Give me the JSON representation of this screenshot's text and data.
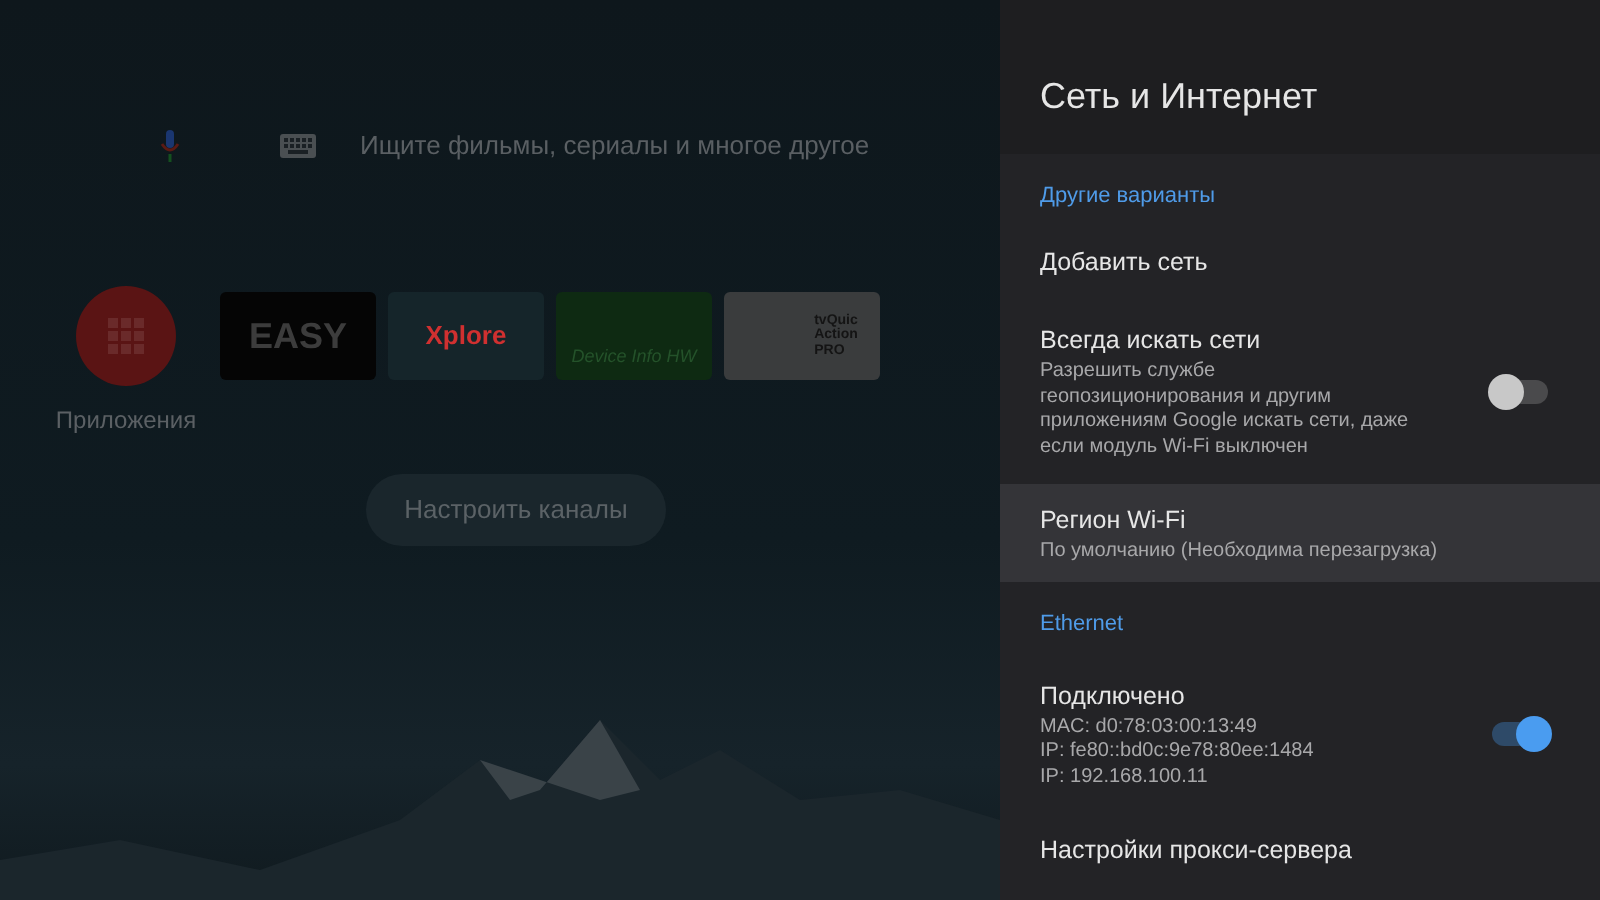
{
  "home": {
    "search": {
      "placeholder": "Ищите фильмы, сериалы и многое другое"
    },
    "apps_button": {
      "label": "Приложения"
    },
    "tiles": [
      {
        "kind": "easy",
        "lines": [
          "EASY"
        ]
      },
      {
        "kind": "xplore",
        "lines": [
          "Xplore"
        ]
      },
      {
        "kind": "deviceinfo",
        "lines": [
          "Device Info HW"
        ]
      },
      {
        "kind": "tvquick",
        "lines": [
          "tvQuic",
          "Action",
          "PRO"
        ]
      }
    ],
    "channels_button": {
      "label": "Настроить каналы"
    }
  },
  "panel": {
    "title": "Сеть и Интернет",
    "items": [
      {
        "kind": "header",
        "title": "Другие варианты"
      },
      {
        "kind": "item",
        "title": "Добавить сеть",
        "selected": false
      },
      {
        "kind": "toggle",
        "title": "Всегда искать сети",
        "lines": [
          "Разрешить службе геопозиционирования и другим приложениям Google искать сети, даже если модуль Wi-Fi выключен"
        ],
        "checked": false,
        "selected": false
      },
      {
        "kind": "item",
        "title": "Регион Wi-Fi",
        "lines": [
          "По умолчанию (Необходима перезагрузка)"
        ],
        "selected": true
      },
      {
        "kind": "header",
        "title": "Ethernet"
      },
      {
        "kind": "toggle",
        "title": "Подключено",
        "lines": [
          "MAC: d0:78:03:00:13:49",
          "IP: fe80::bd0c:9e78:80ee:1484",
          "IP: 192.168.100.11"
        ],
        "checked": true,
        "selected": false
      },
      {
        "kind": "item",
        "title": "Настройки прокси-сервера",
        "selected": false
      }
    ]
  }
}
